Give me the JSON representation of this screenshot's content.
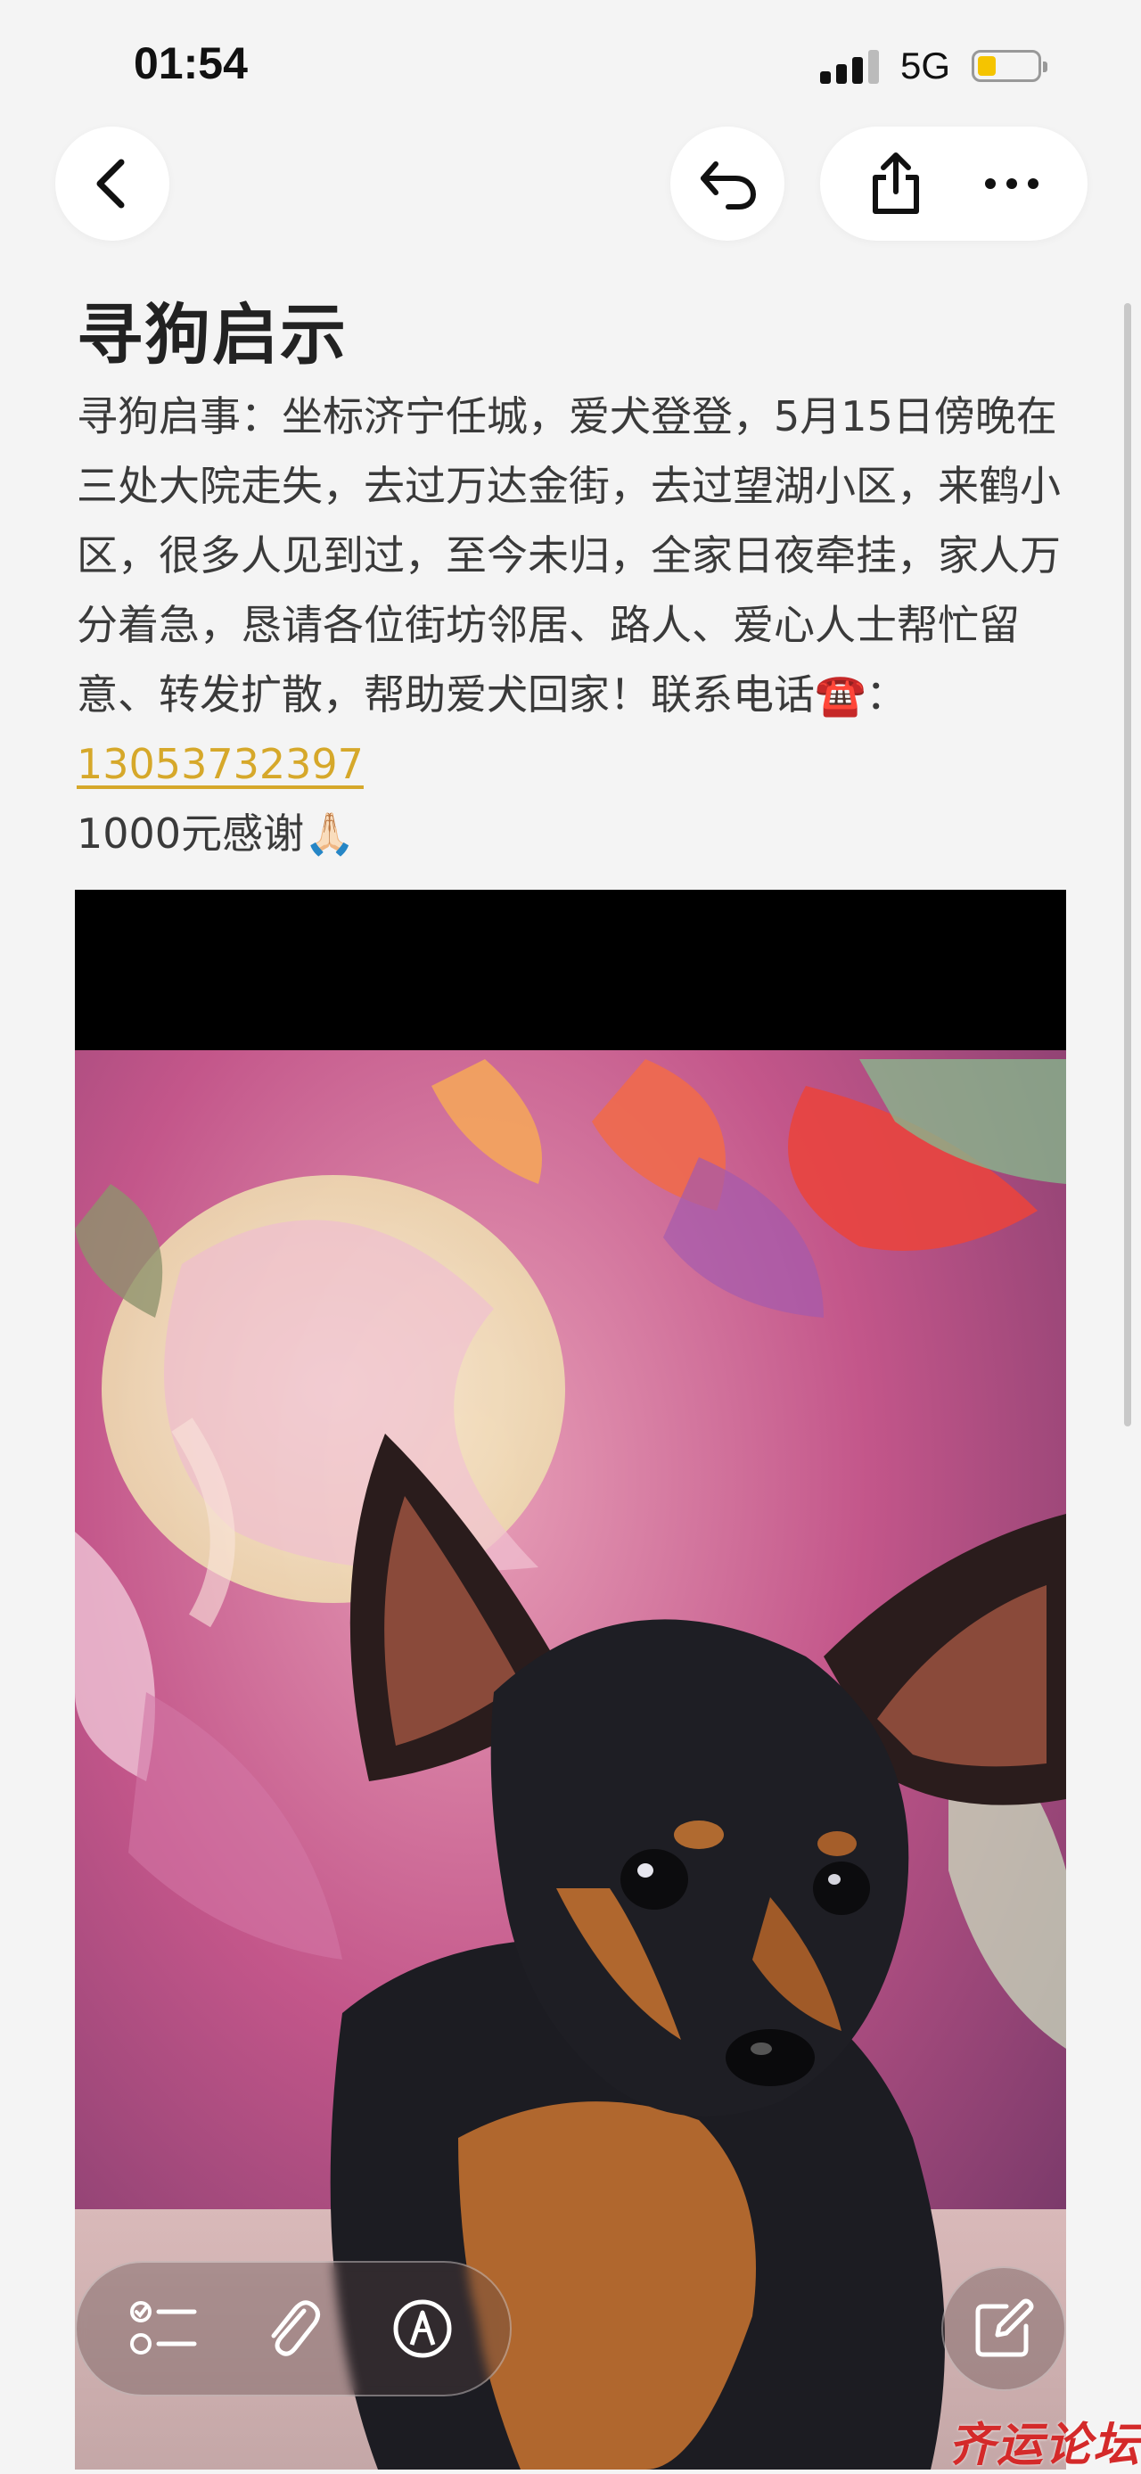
{
  "status_bar": {
    "time": "01:54",
    "network": "5G"
  },
  "nav": {
    "back_icon": "chevron-left-icon",
    "undo_icon": "undo-icon",
    "share_icon": "share-icon",
    "more_icon": "more-icon"
  },
  "note": {
    "title": "寻狗启示",
    "body_text": "寻狗启事：坐标济宁任城，爱犬登登，5月15日傍晚在三处大院走失，去过万达金街，去过望湖小区，来鹤小区，很多人见到过，至今未归，全家日夜牵挂，家人万分着急，恳请各位街坊邻居、路人、爱心人士帮忙留意、转发扩散，帮助爱犬回家！联系电话☎️：",
    "phone": "13053732397",
    "reward": "1000元感谢🙏🏻"
  },
  "toolbar": {
    "checklist_icon": "checklist-icon",
    "attach_icon": "paperclip-icon",
    "markup_icon": "pen-markup-icon",
    "compose_icon": "compose-icon"
  },
  "watermark": {
    "text": "齐运论坛"
  },
  "colors": {
    "background": "#f4f4f4",
    "link": "#d6a82a",
    "watermark": "#d42a2a"
  }
}
